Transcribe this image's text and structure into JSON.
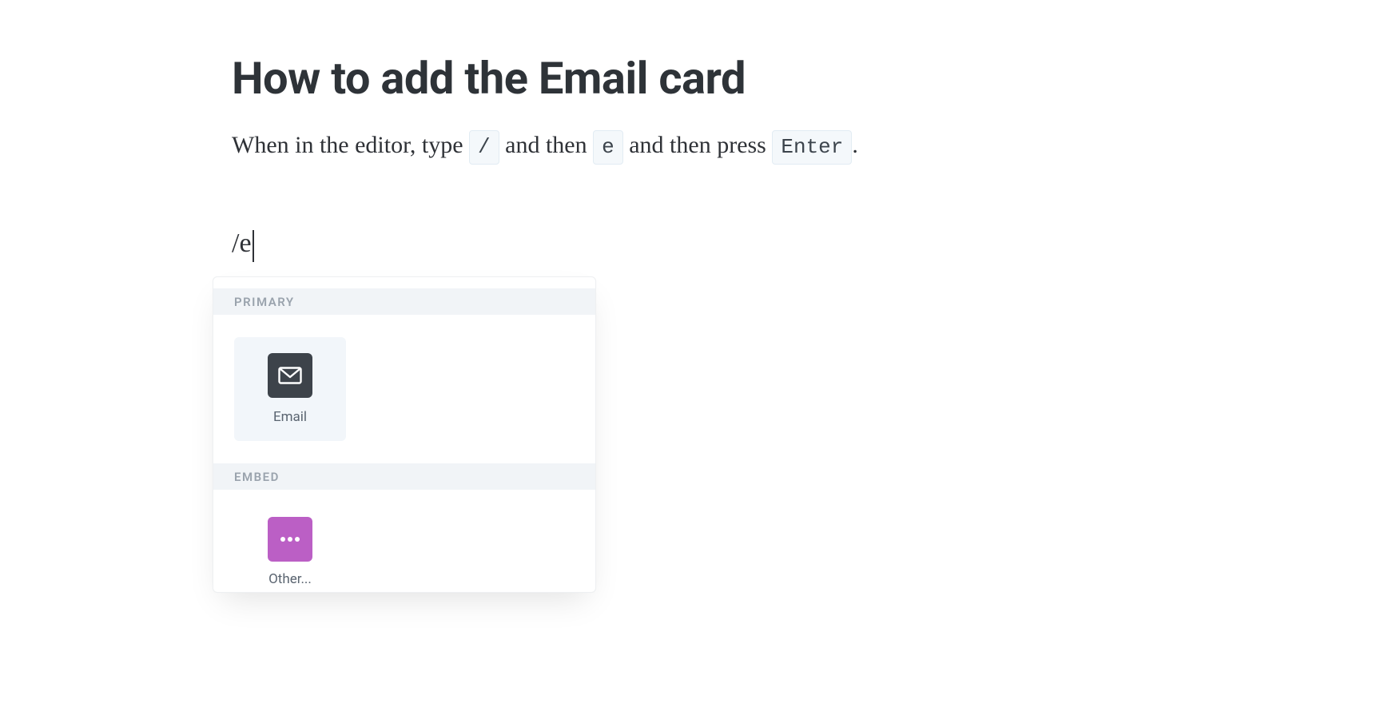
{
  "title": "How to add the Email card",
  "intro": {
    "part1": "When in the editor, type ",
    "kbd1": "/",
    "part2": " and then ",
    "kbd2": "e",
    "part3": " and then press ",
    "kbd3": "Enter",
    "part4": "."
  },
  "editor": {
    "typed": "/e"
  },
  "menu": {
    "groups": [
      {
        "header": "PRIMARY",
        "items": [
          {
            "label": "Email",
            "icon": "email-icon",
            "iconBg": "dark",
            "highlighted": true
          }
        ]
      },
      {
        "header": "EMBED",
        "items": [
          {
            "label": "Other...",
            "icon": "dots-icon",
            "iconBg": "purple",
            "highlighted": false
          }
        ]
      }
    ]
  },
  "colors": {
    "kbdBg": "#f4f8fb",
    "kbdBorder": "#e2ecf3",
    "iconDark": "#3d434a",
    "iconPurple": "#bb5fc5",
    "tileHighlight": "#f2f6fa",
    "groupHeaderBg": "#f1f4f7"
  }
}
